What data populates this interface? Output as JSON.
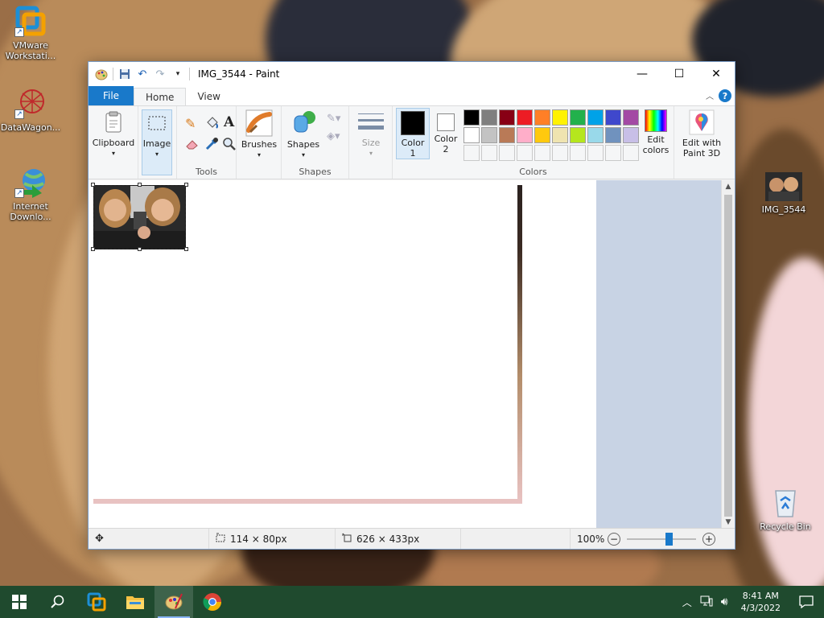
{
  "desktop": {
    "icons": [
      {
        "label": "VMware Workstati..."
      },
      {
        "label": "DataWagon..."
      },
      {
        "label": "Internet Downlo..."
      },
      {
        "label": "IMG_3544"
      },
      {
        "label": "Recycle Bin"
      }
    ]
  },
  "window": {
    "title": "IMG_3544 - Paint",
    "controls": {
      "minimize": "—",
      "maximize": "☐",
      "close": "✕"
    }
  },
  "tabs": {
    "file": "File",
    "home": "Home",
    "view": "View",
    "help": "?"
  },
  "ribbon": {
    "clipboard": {
      "label": "Clipboard"
    },
    "image": {
      "label": "Image"
    },
    "tools": {
      "label": "Tools"
    },
    "brushes": {
      "label": "Brushes"
    },
    "shapes_btn": {
      "label": "Shapes"
    },
    "shapes_group": {
      "label": "Shapes"
    },
    "size": {
      "label": "Size"
    },
    "color1": {
      "line1": "Color",
      "line2": "1"
    },
    "color2": {
      "line1": "Color",
      "line2": "2"
    },
    "colors_group": {
      "label": "Colors"
    },
    "edit_colors": {
      "line1": "Edit",
      "line2": "colors"
    },
    "paint3d": {
      "line1": "Edit with",
      "line2": "Paint 3D"
    },
    "palette": [
      "#000000",
      "#7f7f7f",
      "#880015",
      "#ed1c24",
      "#ff7f27",
      "#fff200",
      "#22b14c",
      "#00a2e8",
      "#3f48cc",
      "#a349a4",
      "#ffffff",
      "#c3c3c3",
      "#b97a57",
      "#ffaec9",
      "#ffc90e",
      "#efe4b0",
      "#b5e61d",
      "#99d9ea",
      "#7092be",
      "#c8bfe7"
    ],
    "color1_value": "#000000",
    "color2_value": "#ffffff"
  },
  "status": {
    "selection_size": "114 × 80px",
    "image_size": "626 × 433px",
    "zoom": "100%",
    "zoom_level": 0.62
  },
  "taskbar": {
    "time": "8:41 AM",
    "date": "4/3/2022"
  }
}
